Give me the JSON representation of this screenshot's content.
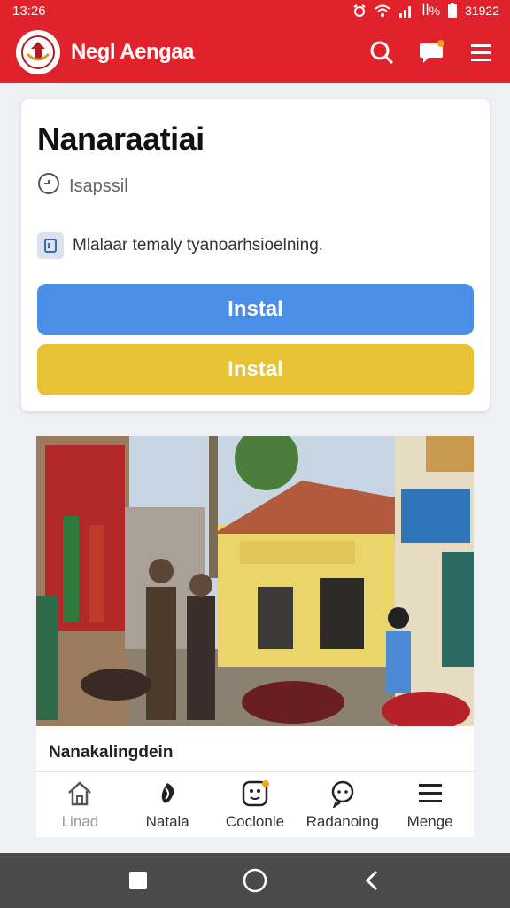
{
  "status_bar": {
    "time": "13:26",
    "carrier": "ꟾꟾ%",
    "clock": "31922"
  },
  "app_bar": {
    "title": "Negl Aengaa",
    "logo_icon": "emblem-icon",
    "actions": [
      "search-icon",
      "chat-icon",
      "menu-icon"
    ]
  },
  "card": {
    "title": "Nanaraatiai",
    "meta": "Isapssil",
    "description": "Mlalaar temaly tyanoarhsioelning.",
    "primary_button": "Instal",
    "secondary_button": "Instal"
  },
  "feed": {
    "caption": "Nanakalingdein"
  },
  "bottom_nav": {
    "items": [
      {
        "label": "Linad",
        "icon": "home-icon"
      },
      {
        "label": "Natala",
        "icon": "leaf-icon"
      },
      {
        "label": "Coclonle",
        "icon": "app-icon"
      },
      {
        "label": "Radanoing",
        "icon": "chat-icon"
      },
      {
        "label": "Menge",
        "icon": "menu-icon"
      }
    ]
  },
  "colors": {
    "brand_red": "#e0222d",
    "primary_blue": "#4a8ee8",
    "accent_yellow": "#e8c235",
    "badge_orange": "#f7a21b"
  }
}
